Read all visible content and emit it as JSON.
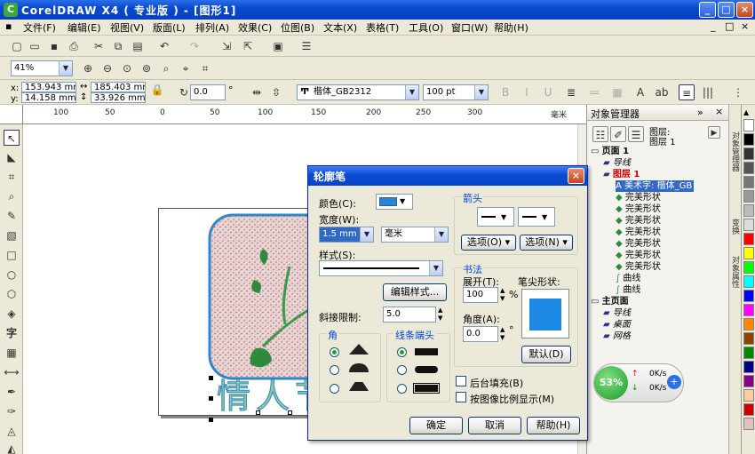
{
  "window": {
    "title": "CorelDRAW X4 ( 专业版 ) - [图形1]",
    "app_icon": "coreldraw-icon",
    "controls": [
      "_",
      "□",
      "×"
    ]
  },
  "menubar": {
    "items": [
      "文件(F)",
      "编辑(E)",
      "视图(V)",
      "版面(L)",
      "排列(A)",
      "效果(C)",
      "位图(B)",
      "文本(X)",
      "表格(T)",
      "工具(O)",
      "窗口(W)",
      "帮助(H)"
    ],
    "doc_controls": [
      "_",
      "□",
      "×"
    ]
  },
  "zoom_toolbar": {
    "zoom_value": "41%"
  },
  "property_bar": {
    "x": "153.943 mm",
    "y": "14.158 mm",
    "width": "185.403 mm",
    "height": "33.926 mm",
    "rotation": "0.0",
    "degree_unit": "°",
    "font_name": "楷体_GB2312",
    "font_size": "100 pt"
  },
  "ruler": {
    "h_ticks": [
      "100",
      "50",
      "0",
      "50",
      "100",
      "150",
      "200",
      "250",
      "300"
    ],
    "v_ticks": [
      "250",
      "200",
      "150",
      "100",
      "50"
    ],
    "unit": "毫米"
  },
  "canvas": {
    "artwork_text": "情人节"
  },
  "object_manager": {
    "title": "对象管理器",
    "header_layer_a": "图层:",
    "header_layer_b": "图层 1",
    "tree": [
      {
        "indent": 0,
        "label": "页面 1",
        "bold": true
      },
      {
        "indent": 1,
        "label": "导线",
        "italic": true
      },
      {
        "indent": 1,
        "label": "图层 1",
        "bold": true,
        "red": true
      },
      {
        "indent": 2,
        "label": "美术字: 楷体_GB",
        "selected": true
      },
      {
        "indent": 2,
        "label": "完美形状"
      },
      {
        "indent": 2,
        "label": "完美形状"
      },
      {
        "indent": 2,
        "label": "完美形状"
      },
      {
        "indent": 2,
        "label": "完美形状"
      },
      {
        "indent": 2,
        "label": "完美形状"
      },
      {
        "indent": 2,
        "label": "完美形状"
      },
      {
        "indent": 2,
        "label": "完美形状"
      },
      {
        "indent": 2,
        "label": "曲线"
      },
      {
        "indent": 2,
        "label": "曲线"
      },
      {
        "indent": 0,
        "label": "主页面",
        "bold": true
      },
      {
        "indent": 1,
        "label": "导线",
        "italic": true
      },
      {
        "indent": 1,
        "label": "桌面",
        "italic": true
      },
      {
        "indent": 1,
        "label": "网格",
        "italic": true
      }
    ]
  },
  "side_tabs": [
    "对象管理器",
    "变换",
    "对象属性"
  ],
  "palette_colors": [
    "#ffffff",
    "#000000",
    "#333333",
    "#555555",
    "#777777",
    "#999999",
    "#bbbbbb",
    "#dddddd",
    "#ff0000",
    "#ffff00",
    "#00ff00",
    "#00ffff",
    "#0000ff",
    "#ff00ff",
    "#ff8800",
    "#884400",
    "#008800",
    "#000088",
    "#880088",
    "#ffcc99",
    "#cc0000",
    "#e0c0c0"
  ],
  "dialog": {
    "title": "轮廓笔",
    "color_label": "颜色(C):",
    "color_value": "#1e88e5",
    "width_label": "宽度(W):",
    "width_value": "1.5 mm",
    "width_unit": "毫米",
    "style_label": "样式(S):",
    "edit_style_button": "编辑样式...",
    "miter_label": "斜接限制:",
    "miter_value": "5.0",
    "corners_group": "角",
    "line_caps_group": "线条端头",
    "arrows_group": "箭头",
    "arrow_options_left": "选项(O)",
    "arrow_options_right": "选项(N)",
    "calligraphy_group": "书法",
    "stretch_label": "展开(T):",
    "stretch_value": "100",
    "percent": "%",
    "angle_label": "角度(A):",
    "angle_value": "0.0",
    "degree_unit": "°",
    "nib_shape_label": "笔尖形状:",
    "default_button": "默认(D)",
    "behind_fill": "后台填充(B)",
    "scale_with_image": "按图像比例显示(M)",
    "ok_button": "确定",
    "cancel_button": "取消",
    "help_button": "帮助(H)"
  },
  "net_widget": {
    "percent": "53%",
    "up": "0K/s",
    "down": "0K/s"
  }
}
